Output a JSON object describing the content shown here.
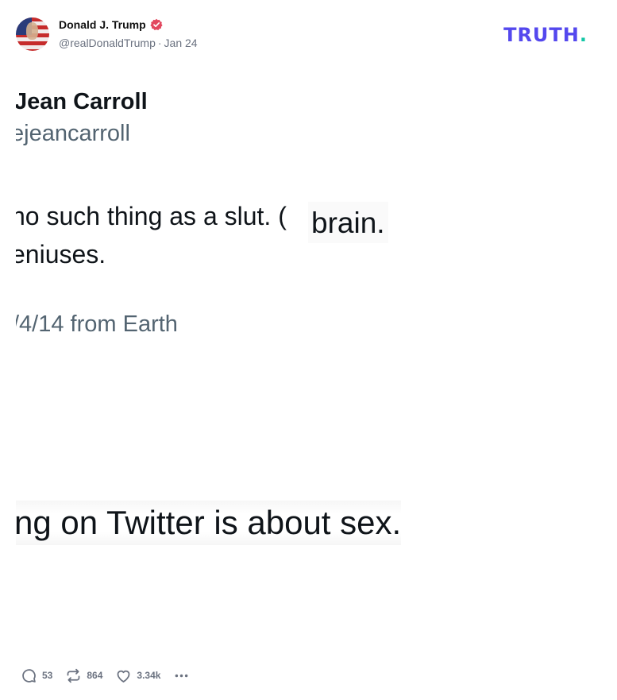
{
  "post": {
    "author": "Donald J. Trump",
    "handle": "@realDonaldTrump",
    "separator": "·",
    "date": "Jan 24",
    "brand": "TRUTH",
    "brand_dot": ".",
    "colors": {
      "brand": "#5448ee",
      "brand_dot": "#13c7a6",
      "verified": "#e2485f"
    }
  },
  "screenshot": {
    "author_name": "Jean Carroll",
    "author_handle": "ejeancarroll",
    "line1": "no such thing as a slut. (",
    "patch": "brain.",
    "line2": "eniuses.",
    "date_line": "/4/14 from Earth",
    "bottom_line": "ng on Twitter is about sex."
  },
  "actions": {
    "replies": "53",
    "retruths": "864",
    "likes": "3.34k",
    "icons": [
      "reply-icon",
      "retruth-icon",
      "like-icon",
      "more-icon"
    ]
  }
}
